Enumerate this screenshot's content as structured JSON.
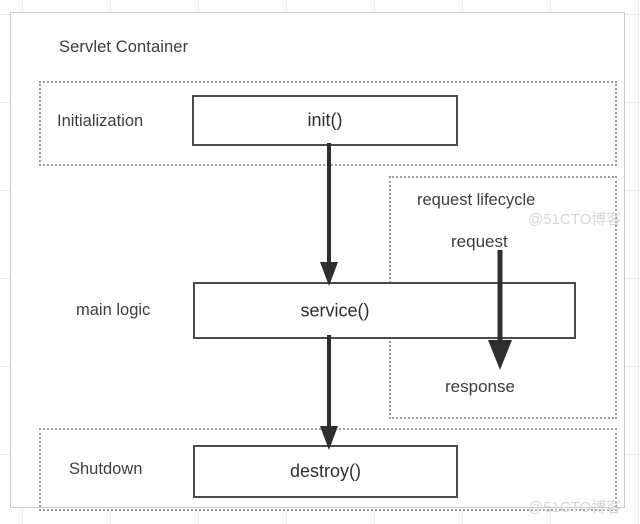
{
  "diagram": {
    "title": "Servlet Container",
    "phases": [
      {
        "id": "initialization",
        "label": "Initialization"
      },
      {
        "id": "main-logic",
        "label": "main logic"
      },
      {
        "id": "shutdown",
        "label": "Shutdown"
      }
    ],
    "lifecycle_region": {
      "label": "request lifecycle",
      "request_label": "request",
      "response_label": "response"
    },
    "method_boxes": [
      {
        "id": "init",
        "label": "init()"
      },
      {
        "id": "service",
        "label": "service()"
      },
      {
        "id": "destroy",
        "label": "destroy()"
      }
    ],
    "flows": [
      {
        "id": "init-to-service",
        "from": "init()",
        "to": "service()"
      },
      {
        "id": "service-to-destroy",
        "from": "service()",
        "to": "destroy()"
      },
      {
        "id": "request-to-response",
        "from": "request",
        "to": "response"
      }
    ],
    "colors": {
      "box_border": "#4a4a4c",
      "region_border": "#9b9b9e",
      "container_border": "#c9c9cb",
      "text": "#3d3d3f",
      "arrow": "#2e2e30",
      "grid": "#ececed",
      "watermark": "#d6d6da"
    },
    "watermark": "@51CTO博客"
  }
}
